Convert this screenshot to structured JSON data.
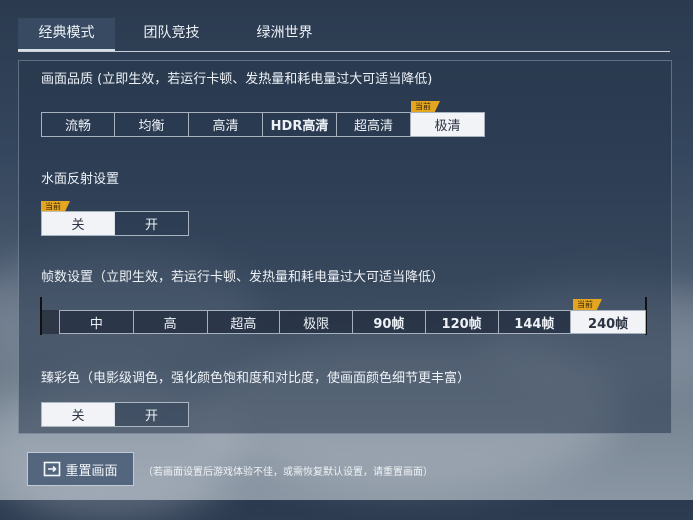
{
  "tabs": [
    {
      "label": "经典模式"
    },
    {
      "label": "团队竞技"
    },
    {
      "label": "绿洲世界"
    }
  ],
  "quality": {
    "label": "画面品质 (立即生效，若运行卡顿、发热量和耗电量过大可适当降低)",
    "options": [
      "流畅",
      "均衡",
      "高清",
      "HDR高清",
      "超高清",
      "极清"
    ],
    "selected": "极清",
    "badge": "当前"
  },
  "water": {
    "label": "水面反射设置",
    "options": [
      "关",
      "开"
    ],
    "selected": "关",
    "badge": "当前"
  },
  "fps": {
    "label": "帧数设置（立即生效，若运行卡顿、发热量和耗电量过大可适当降低）",
    "options": [
      "中",
      "高",
      "超高",
      "极限",
      "90帧",
      "120帧",
      "144帧",
      "240帧"
    ],
    "selected": "240帧",
    "badge": "当前"
  },
  "color": {
    "label": "臻彩色（电影级调色，强化颜色饱和度和对比度，使画面颜色细节更丰富）",
    "options": [
      "关",
      "开"
    ],
    "selected": "关"
  },
  "reset": {
    "label": "重置画面",
    "icon": "reset-icon",
    "note": "（若画面设置后游戏体验不佳，或需恢复默认设置，请重置画面）"
  }
}
